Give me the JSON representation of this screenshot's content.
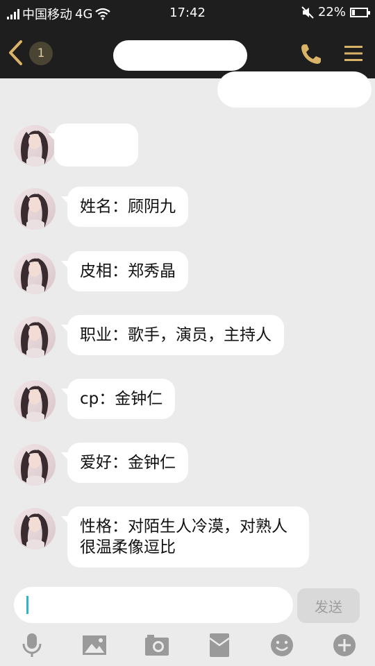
{
  "status_bar": {
    "carrier": "中国移动",
    "network": "4G",
    "time": "17:42",
    "battery_percent": "22%",
    "battery_level": 0.22
  },
  "header": {
    "unread_count": "1",
    "icons": [
      "back-chevron-icon",
      "phone-icon",
      "menu-icon"
    ]
  },
  "messages": [
    {
      "text": ""
    },
    {
      "text": "姓名：顾阴九"
    },
    {
      "text": "皮相：郑秀晶"
    },
    {
      "text": "职业：歌手，演员，主持人"
    },
    {
      "text": "cp：金钟仁"
    },
    {
      "text": "爱好：金钟仁"
    },
    {
      "text": "性格：对陌生人冷漠，对熟人很温柔像逗比"
    }
  ],
  "composer": {
    "input_value": "",
    "send_label": "发送",
    "tools": [
      "microphone-icon",
      "image-icon",
      "camera-icon",
      "red-packet-icon",
      "emoji-icon",
      "plus-icon"
    ]
  },
  "colors": {
    "header_bg": "#1e1e1e",
    "accent_gold": "#d9b468",
    "chat_bg": "#ebebeb",
    "caret": "#2fb7c9"
  }
}
